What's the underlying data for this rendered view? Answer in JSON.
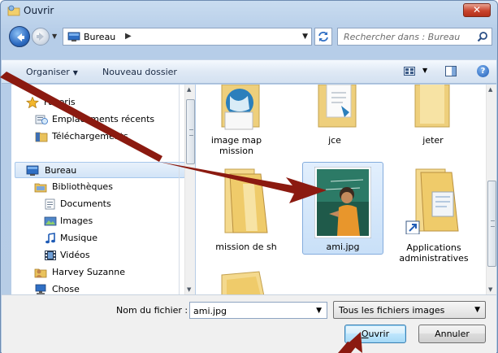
{
  "window": {
    "title": "Ouvrir",
    "close_label": "✕"
  },
  "address": {
    "location": "Bureau",
    "separator": "▶",
    "search_placeholder": "Rechercher dans : Bureau"
  },
  "toolbar": {
    "organise_label": "Organiser",
    "new_folder_label": "Nouveau dossier",
    "help_label": "?"
  },
  "nav": {
    "items": [
      {
        "label": "Favoris",
        "icon": "star-icon"
      },
      {
        "label": "Emplacements récents",
        "icon": "recent-places-icon"
      },
      {
        "label": "Téléchargements",
        "icon": "downloads-folder-icon"
      },
      {
        "label": "Bureau",
        "icon": "desktop-icon",
        "selected": true
      },
      {
        "label": "Bibliothèques",
        "icon": "libraries-icon"
      },
      {
        "label": "Documents",
        "icon": "documents-icon"
      },
      {
        "label": "Images",
        "icon": "images-icon"
      },
      {
        "label": "Musique",
        "icon": "music-icon"
      },
      {
        "label": "Vidéos",
        "icon": "videos-icon"
      },
      {
        "label": "Harvey Suzanne",
        "icon": "user-folder-icon"
      },
      {
        "label": "Chose",
        "icon": "network-icon"
      }
    ]
  },
  "files": {
    "items": [
      {
        "name": "image map mission",
        "type": "folder"
      },
      {
        "name": "jce",
        "type": "folder"
      },
      {
        "name": "jeter",
        "type": "folder"
      },
      {
        "name": "mission de sh",
        "type": "folder"
      },
      {
        "name": "ami.jpg",
        "type": "image",
        "selected": true
      },
      {
        "name": "Applications administratives",
        "type": "shortcut"
      }
    ]
  },
  "bottom": {
    "filename_label": "Nom du fichier :",
    "filename_value": "ami.jpg",
    "filetype_value": "Tous les fichiers images",
    "open_label_first": "O",
    "open_label_rest": "uvrir",
    "cancel_label": "Annuler"
  },
  "colors": {
    "annotation_arrow": "#8b1a10",
    "selection": "#c9e0f8",
    "accent": "#1f5cb6"
  }
}
